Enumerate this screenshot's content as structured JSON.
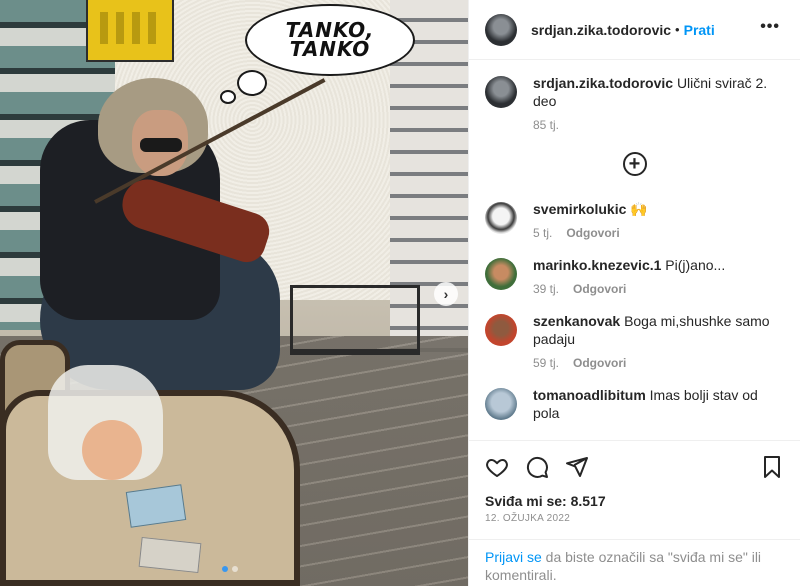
{
  "post": {
    "username": "srdjan.zika.todorovic",
    "follow_label": "Prati",
    "more_label": "•••",
    "image_bubble_text": "TANKO,\nTANKO",
    "caption": {
      "username": "srdjan.zika.todorovic",
      "text": "Ulični svirač 2. deo",
      "time": "85 tj."
    },
    "load_more_icon": "plus-circle-icon",
    "comments": [
      {
        "username": "svemirkolukic",
        "text": "🙌",
        "time": "5 tj.",
        "reply": "Odgovori"
      },
      {
        "username": "marinko.knezevic.1",
        "text": "Pi(j)ano...",
        "time": "39 tj.",
        "reply": "Odgovori"
      },
      {
        "username": "szenkanovak",
        "text": "Boga mi,shushke samo padaju",
        "time": "59 tj.",
        "reply": "Odgovori"
      },
      {
        "username": "tomanoadlibitum",
        "text": "Imas bolji stav od pola",
        "time": "",
        "reply": ""
      }
    ],
    "likes_label": "Sviđa mi se: 8.517",
    "date": "12. OŽUJKA 2022",
    "login_prompt": {
      "link": "Prijavi se",
      "text": " da biste označili sa \"sviđa mi se\" ili komentirali."
    }
  },
  "icons": [
    "heart-icon",
    "comment-icon",
    "share-icon",
    "bookmark-icon",
    "chevron-right-icon"
  ],
  "colors": {
    "link": "#0095f6",
    "muted": "#8e8e8e",
    "text": "#262626",
    "dot_active": "#3897f0"
  }
}
